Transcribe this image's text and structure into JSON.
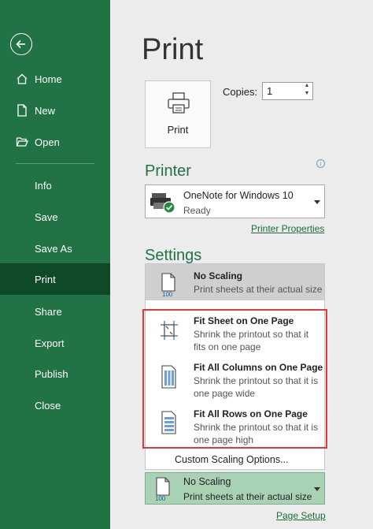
{
  "sidebar": {
    "back_icon": "back-arrow-icon",
    "items": [
      {
        "label": "Home",
        "icon": "home-icon"
      },
      {
        "label": "New",
        "icon": "new-document-icon"
      },
      {
        "label": "Open",
        "icon": "folder-open-icon"
      },
      {
        "label": "Info"
      },
      {
        "label": "Save"
      },
      {
        "label": "Save As"
      },
      {
        "label": "Print",
        "active": true
      },
      {
        "label": "Share"
      },
      {
        "label": "Export"
      },
      {
        "label": "Publish"
      },
      {
        "label": "Close"
      }
    ],
    "accent_color": "#217346",
    "active_color": "#0f4a28"
  },
  "main": {
    "title": "Print",
    "print_button_label": "Print",
    "copies_label": "Copies:",
    "copies_value": "1",
    "printer_heading": "Printer",
    "printer": {
      "name": "OneNote for Windows 10",
      "status": "Ready"
    },
    "printer_properties_link": "Printer Properties",
    "settings_heading": "Settings",
    "scaling_options": [
      {
        "title": "No Scaling",
        "desc": "Print sheets at their actual size",
        "selected": true,
        "icon": "no-scaling-icon"
      },
      {
        "title": "Fit Sheet on One Page",
        "desc": "Shrink the printout so that it fits on one page",
        "icon": "fit-sheet-icon"
      },
      {
        "title": "Fit All Columns on One Page",
        "desc": "Shrink the printout so that it is one page wide",
        "icon": "fit-columns-icon"
      },
      {
        "title": "Fit All Rows on One Page",
        "desc": "Shrink the printout so that it is one page high",
        "icon": "fit-rows-icon"
      }
    ],
    "custom_scaling_label": "Custom Scaling Options...",
    "current_scaling": {
      "title": "No Scaling",
      "desc": "Print sheets at their actual size"
    },
    "page_setup_link": "Page Setup",
    "highlight_color": "#e03b3b"
  }
}
